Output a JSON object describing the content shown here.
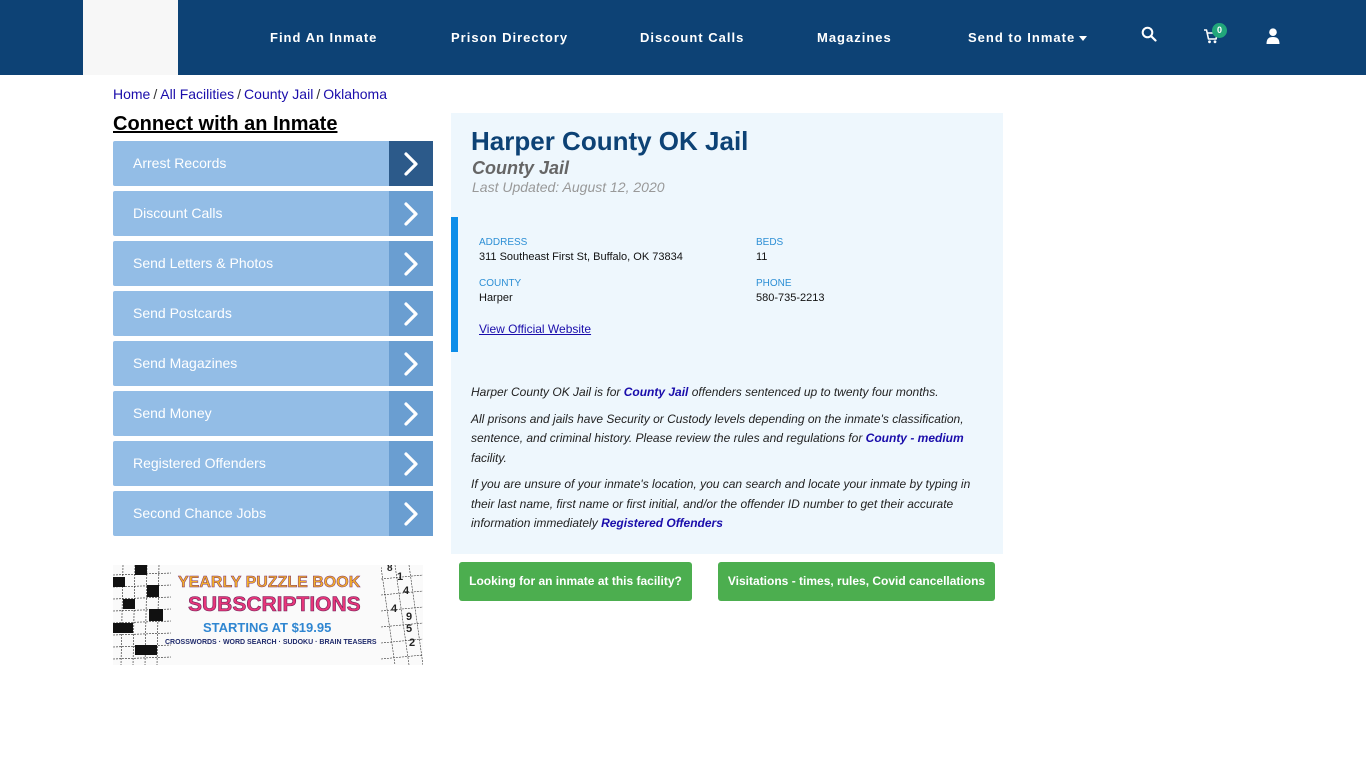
{
  "header": {
    "nav": [
      {
        "label": "Find An Inmate"
      },
      {
        "label": "Prison Directory"
      },
      {
        "label": "Discount Calls"
      },
      {
        "label": "Magazines"
      },
      {
        "label": "Send to Inmate",
        "has_dropdown": true
      }
    ],
    "icons": {
      "search": "search-icon",
      "cart": "cart-icon",
      "user": "user-icon"
    },
    "cart_count": "0",
    "colors": {
      "bar": "#0d4275",
      "badge": "#21a67a"
    }
  },
  "breadcrumb": [
    {
      "label": "Home"
    },
    {
      "label": "All Facilities"
    },
    {
      "label": "County Jail"
    },
    {
      "label": "Oklahoma"
    }
  ],
  "sidebar": {
    "heading": "Connect with an Inmate",
    "items": [
      {
        "label": "Arrest Records",
        "active": true
      },
      {
        "label": "Discount Calls"
      },
      {
        "label": "Send Letters & Photos"
      },
      {
        "label": "Send Postcards"
      },
      {
        "label": "Send Magazines"
      },
      {
        "label": "Send Money"
      },
      {
        "label": "Registered Offenders"
      },
      {
        "label": "Second Chance Jobs"
      }
    ]
  },
  "ad": {
    "line1": "YEARLY PUZZLE BOOK",
    "line2": "SUBSCRIPTIONS",
    "line3": "STARTING AT $19.95",
    "line4": "CROSSWORDS · WORD SEARCH · SUDOKU · BRAIN TEASERS",
    "sudoku_digits": [
      "8",
      "1",
      "4",
      "4",
      "9",
      "5",
      "2"
    ]
  },
  "facility": {
    "title": "Harper County OK Jail",
    "type": "County Jail",
    "last_updated": "Last Updated: August 12, 2020",
    "info": {
      "address_label": "ADDRESS",
      "address": "311 Southeast First St, Buffalo, OK 73834",
      "beds_label": "BEDS",
      "beds": "11",
      "county_label": "COUNTY",
      "county": "Harper",
      "phone_label": "PHONE",
      "phone": "580-735-2213",
      "website_link": "View Official Website"
    },
    "description": {
      "p1_a": "Harper County OK Jail is for ",
      "p1_link": "County Jail",
      "p1_b": " offenders sentenced up to twenty four months.",
      "p2_a": "All prisons and jails have Security or Custody levels depending on the inmate's classification, sentence, and criminal history. Please review the rules and regulations for ",
      "p2_link": "County - medium",
      "p2_b": " facility.",
      "p3_a": "If you are unsure of your inmate's location, you can search and locate your inmate by typing in their last name, first name or first initial, and/or the offender ID number to get their accurate information immediately ",
      "p3_link": "Registered Offenders"
    }
  },
  "buttons": {
    "find_inmate": "Looking for an inmate at this facility?",
    "visitations": "Visitations - times, rules, Covid cancellations"
  }
}
